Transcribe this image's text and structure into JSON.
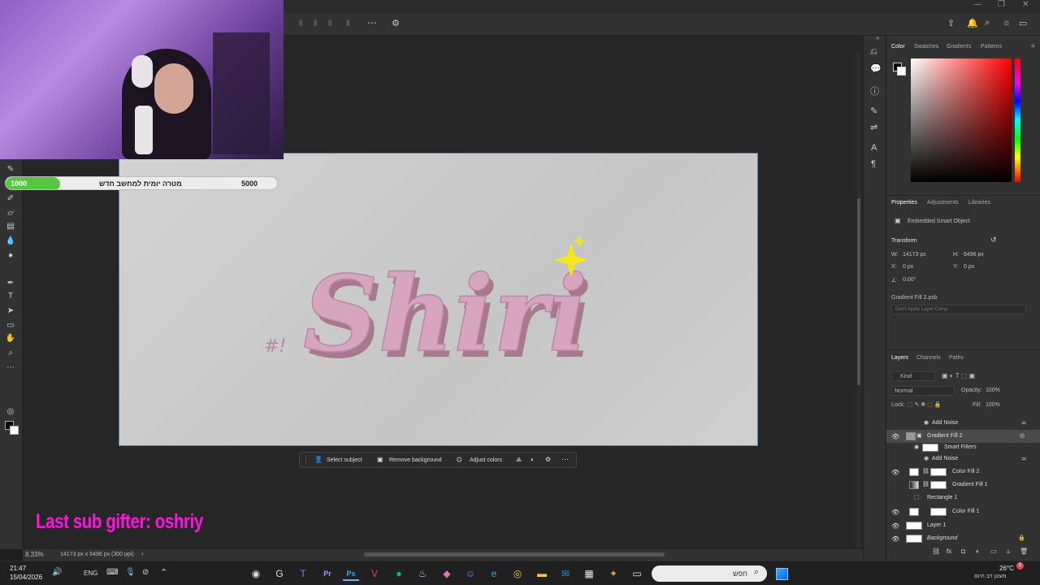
{
  "progress": {
    "current": "1000",
    "goal": "5000",
    "label": "מטרה יומית למחשב חדש",
    "fraction": 0.2
  },
  "canvas_text": {
    "title": "Shiri",
    "tag": "#!"
  },
  "overlay": {
    "sub_gifter": "Last sub gifter: oshriy"
  },
  "contextbar": {
    "select_subject": "Select subject",
    "remove_bg": "Remove background",
    "adjust": "Adjust colors"
  },
  "status": {
    "zoom": "8.33%",
    "doc": "14173 px x 6496 px (300 ppi)"
  },
  "color_panel": {
    "tabs": [
      "Color",
      "Swatches",
      "Gradients",
      "Patterns"
    ],
    "hue": "#ff0000"
  },
  "properties": {
    "tabs": [
      "Properties",
      "Adjustments",
      "Libraries"
    ],
    "type": "Embedded Smart Object",
    "section": "Transform",
    "w_label": "W:",
    "w": "14173 px",
    "h_label": "H:",
    "h": "6496 px",
    "x_label": "X:",
    "x": "0 px",
    "y_label": "Y:",
    "y": "0 px",
    "angle": "0.00°",
    "file": "Gradient Fill 2.psb",
    "comp": "Don't Apply Layer Comp"
  },
  "layers_panel": {
    "tabs": [
      "Layers",
      "Channels",
      "Paths"
    ],
    "kind": "Kind",
    "blend": "Normal",
    "opacity_label": "Opacity:",
    "opacity": "100%",
    "lock_label": "Lock:",
    "fill_label": "Fill:",
    "fill": "100%",
    "items": [
      {
        "name": "Add Noise"
      },
      {
        "name": "Gradient Fill 2"
      },
      {
        "name": "Smart Filters"
      },
      {
        "name": "Add Noise"
      },
      {
        "name": "Color Fill 2"
      },
      {
        "name": "Gradient Fill 1"
      },
      {
        "name": "Rectangle 1"
      },
      {
        "name": "Color Fill 1"
      },
      {
        "name": "Layer 1"
      },
      {
        "name": "Background"
      }
    ]
  },
  "taskbar": {
    "time": "21:47",
    "date": "15/04/2026",
    "lang": "ENG",
    "search_placeholder": "חפש",
    "weather_temp": "26°C",
    "weather_text": "מעונן רב היום",
    "badge": "5"
  }
}
